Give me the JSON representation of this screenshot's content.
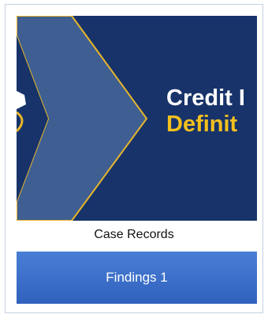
{
  "card": {
    "thumbnail": {
      "title_line1": "Credit I",
      "title_line2": "Definit",
      "colors": {
        "background": "#17336a",
        "chevron_fill": "#3f5f92",
        "chevron_border": "#e7b52b",
        "title_primary": "#ffffff",
        "title_accent": "#f4c01e"
      }
    },
    "caption": "Case Records",
    "findings_button": {
      "label": "Findings 1",
      "color": "#3b6fc9"
    }
  }
}
